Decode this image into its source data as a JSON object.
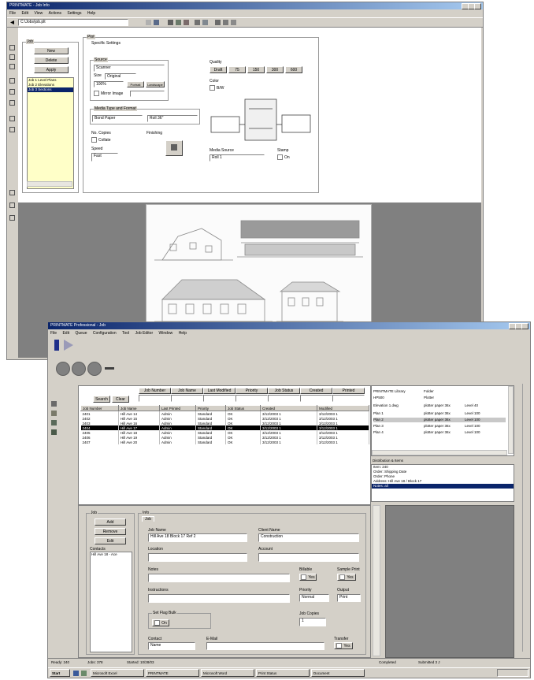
{
  "colors": {
    "titlebar": "#0a246a",
    "selection": "#0a246a",
    "yellow_list": "#ffffc8",
    "dark_panel": "#808080"
  },
  "back_window": {
    "title": "PRINTMATE - Job Info",
    "menu": [
      "File",
      "Edit",
      "View",
      "Actions",
      "Settings",
      "Help"
    ],
    "address_value": "C:\\Jobs\\job.plt",
    "left_tools": [
      "select-tool-icon",
      "move-tool-icon",
      "zoom-tool-icon",
      "pan-tool-icon",
      "measure-tool-icon",
      "text-tool-icon",
      "line-tool-icon",
      "rotate-tool-icon",
      "stamp-tool-icon",
      "layer-tool-icon",
      "print-tool-icon"
    ],
    "job_panel": {
      "caption": "Job",
      "buttons": [
        "New",
        "Delete",
        "Apply"
      ],
      "list": [
        "Job 1 Level Plans",
        "Job 2 Elevations",
        "Job 3 Sections"
      ],
      "selected_index": 2
    },
    "panel": {
      "caption": "Plot",
      "tab": "Specific Settings",
      "source_caption": "Source",
      "source_value": "Scanner",
      "size_label": "Size",
      "size_value": "Original",
      "scale_value": "100%",
      "portrait_label": "Portrait",
      "landscape_label": "Landscape",
      "mirror_label": "Mirror Image",
      "media_caption": "Media Type and Format",
      "media_type": "Bond Paper",
      "media_format": "Roll 36\"",
      "copies_caption": "No. Copies",
      "copies_value": "1",
      "collate_label": "Collate",
      "finishing_caption": "Finishing",
      "speed_caption": "Speed",
      "speed_value": "Fast",
      "quality_caption": "Quality",
      "quality_options": [
        "Draft",
        "75",
        "150",
        "300",
        "600"
      ],
      "quality_selected": "Draft",
      "color_caption": "Color",
      "color_check": "B/W",
      "media_source_caption": "Media Source",
      "media_source_value": "Roll 1",
      "stamp_caption": "Stamp",
      "stamp_check": "On"
    }
  },
  "front_window": {
    "title": "PRINTMATE Professional - Job",
    "menu": [
      "File",
      "Edit",
      "Queue",
      "Configuration",
      "Tool",
      "Job Editor",
      "Window",
      "Help"
    ],
    "search_button": "Search",
    "clear_button": "Clear",
    "filter_headers": [
      "Job Number",
      "Job Name",
      "Last Modified",
      "Priority",
      "Job Status",
      "Created",
      "Printed"
    ],
    "job_columns": [
      "Job Number",
      "Job Name",
      "Last Printed",
      "Priority",
      "Job Status",
      "Created",
      "Modified"
    ],
    "jobs": [
      [
        "2401",
        "Hill Ave 14",
        "Admin",
        "Standard",
        "OK",
        "3/12/2003 1",
        "3/12/2003 1"
      ],
      [
        "2402",
        "Hill Ave 15",
        "Admin",
        "Standard",
        "OK",
        "3/12/2003 1",
        "3/12/2003 1"
      ],
      [
        "2403",
        "Hill Ave 16",
        "Admin",
        "Standard",
        "OK",
        "3/12/2003 1",
        "3/12/2003 1"
      ],
      [
        "2404",
        "Hill Ave 17",
        "Admin",
        "Standard",
        "OK",
        "3/12/2003 1",
        "3/12/2003 1"
      ],
      [
        "2405",
        "Hill Ave 18",
        "Admin",
        "Standard",
        "OK",
        "3/12/2003 1",
        "3/12/2003 1"
      ],
      [
        "2406",
        "Hill Ave 19",
        "Admin",
        "Standard",
        "OK",
        "3/12/2003 1",
        "3/12/2003 1"
      ],
      [
        "2407",
        "Hill Ave 20",
        "Admin",
        "Standard",
        "OK",
        "3/12/2003 1",
        "3/12/2003 1"
      ]
    ],
    "selected_job_index": 3,
    "tree": {
      "items": [
        {
          "name": "PRINTMATE Library",
          "type": "Folder",
          "size": "",
          "layer": ""
        },
        {
          "name": "HP500",
          "type": "Plotter",
          "size": "",
          "layer": ""
        },
        {
          "name": "Elevation 1.dwg",
          "type": "plotter paper 36x",
          "size": "Level 40",
          "layer": ""
        },
        {
          "name": "Plan 1",
          "type": "plotter paper 36x",
          "size": "Level 100",
          "layer": ""
        },
        {
          "name": "Plan 2",
          "type": "plotter paper 36x",
          "size": "Level 100",
          "layer": ""
        },
        {
          "name": "Plan 3",
          "type": "plotter paper 36x",
          "size": "Level 100",
          "layer": ""
        },
        {
          "name": "Plan 4",
          "type": "plotter paper 36x",
          "size": "Level 100",
          "layer": ""
        }
      ],
      "selected_index": 4
    },
    "details": {
      "caption": "Distribution & Items",
      "lines": [
        "Item: 240",
        "Order: Shipping Date",
        "Order: Phone",
        "Address: Hill Ave 18 / Block 17"
      ],
      "selected_line": "Notes: all"
    },
    "bottom": {
      "left_caption": "Job",
      "buttons": [
        "Add",
        "Remove",
        "Edit"
      ],
      "contacts_label": "Contacts",
      "contacts_value": "Hill Ave 18 - Ace",
      "form_caption": "Info",
      "tab": "Job",
      "job_name_label": "Job Name",
      "job_name_value": "Hill Ave 18 Block 17   Ref 2",
      "client_name_label": "Client Name",
      "client_name_value": "Construction",
      "location_label": "Location",
      "account_label": "Account",
      "notes_label": "Notes",
      "billable_label": "Billable",
      "billable_check": "Yes",
      "instructions_label": "Instructions",
      "priority_label": "Priority",
      "priority_value": "Normal",
      "sample_print_label": "Sample Print",
      "sample_check": "Yes",
      "output_label": "Output",
      "output_value": "Print",
      "file_tag_caption": "Set Flag Bulk",
      "file_tag_check": "On",
      "job_copies_label": "Job Copies",
      "job_copies_value": "1",
      "contact_label": "Contact",
      "contact_value": "Name",
      "email_label": "E-Mail",
      "transfer_label": "Transfer",
      "transfer_check": "Yes"
    },
    "status": [
      "Ready: 240",
      "Jobs: 378",
      "Started: 10/28/03",
      "Completed",
      "Submitted 3 J"
    ],
    "taskbar": [
      "Start",
      "",
      "",
      "Microsoft Excel",
      "PRINTMATE",
      "Microsoft Word",
      "Print Status",
      "Document"
    ]
  }
}
